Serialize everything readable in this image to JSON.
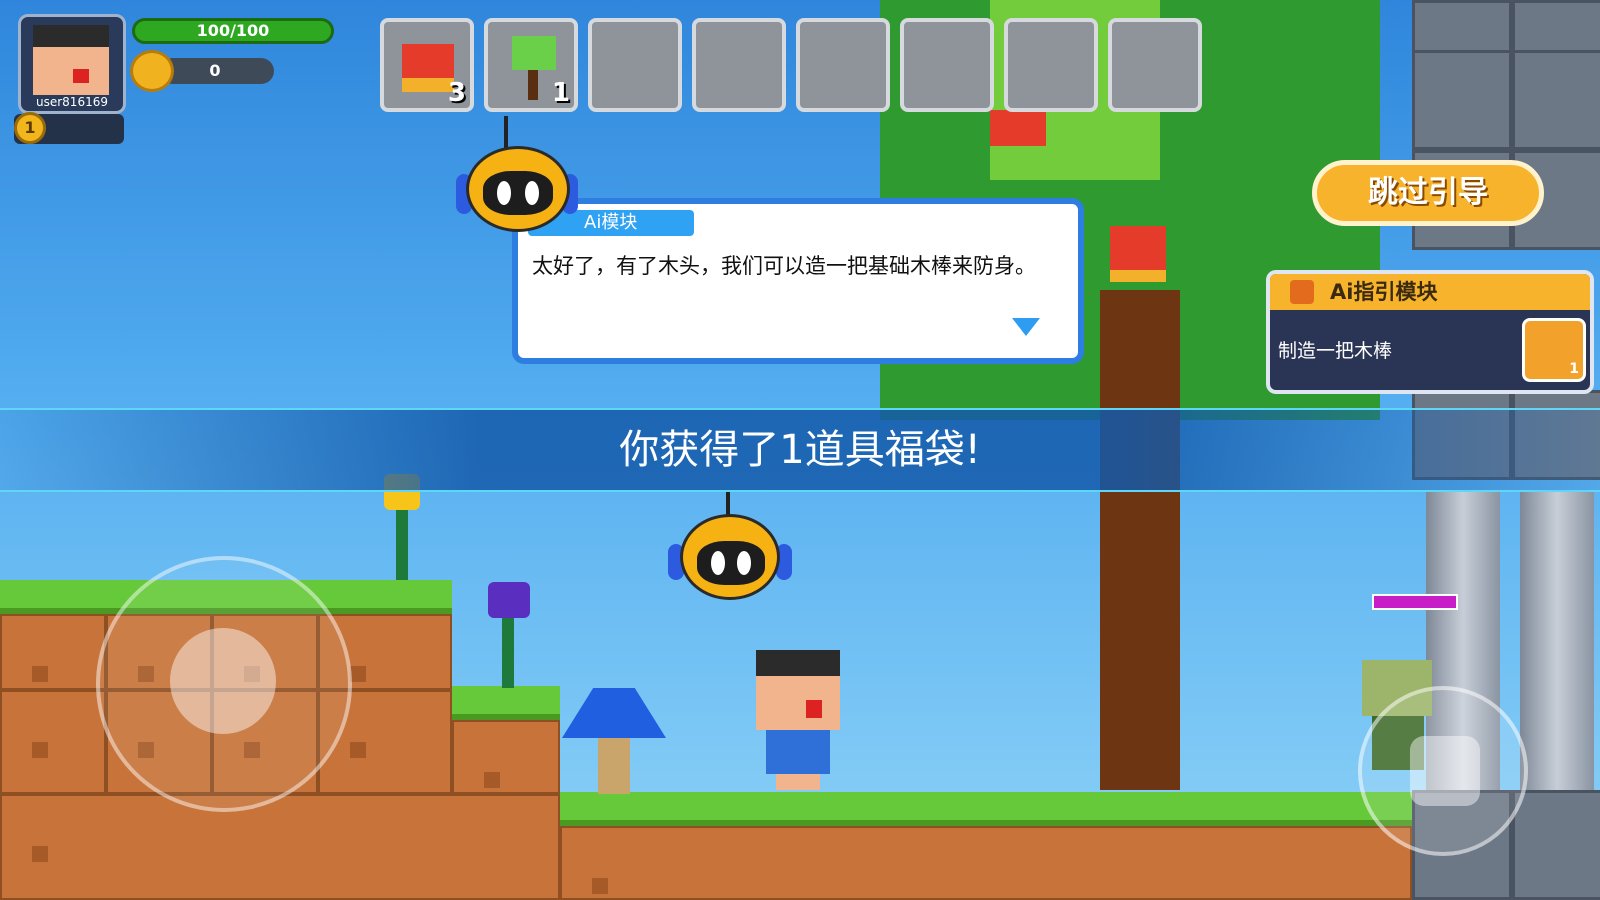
{
  "player": {
    "username": "user816169",
    "hp_text": "100/100",
    "hp_fraction": 1.0,
    "coins": "0",
    "level": "1"
  },
  "inventory": {
    "slots": [
      {
        "item": "apple-icon",
        "count": "3"
      },
      {
        "item": "sapling-icon",
        "count": "1"
      },
      {
        "item": "",
        "count": ""
      },
      {
        "item": "",
        "count": ""
      },
      {
        "item": "",
        "count": ""
      },
      {
        "item": "",
        "count": ""
      },
      {
        "item": "",
        "count": ""
      },
      {
        "item": "",
        "count": ""
      }
    ]
  },
  "dialog": {
    "speaker": "Ai模块",
    "text": "太好了，有了木头，我们可以造一把基础木棒来防身。"
  },
  "banner": {
    "text": "你获得了1道具福袋!"
  },
  "skip_button": {
    "label": "跳过引导"
  },
  "guide": {
    "title": "Ai指引模块",
    "task": "制造一把木棒",
    "reward_count": "1"
  },
  "colors": {
    "accent_blue": "#2e7de0",
    "accent_orange": "#f7b32b",
    "hp_green": "#2ea821"
  }
}
